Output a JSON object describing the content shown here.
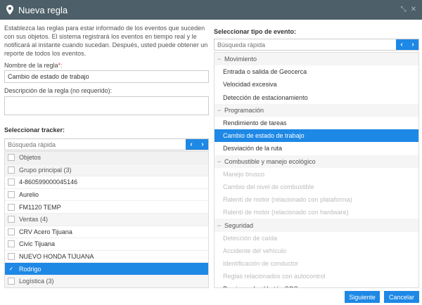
{
  "window": {
    "title": "Nueva regla"
  },
  "intro": "Establezca las reglas para estar informado de los eventos que suceden con sus objetos. El sistema registrará los eventos en tiempo real y le notificará al instante cuando sucedan. Después, usted puede obtener un reporte de todos los eventos.",
  "rule_name": {
    "label": "Nombre de la regla",
    "required_mark": "*:",
    "value": "Cambio de estado de trabajo"
  },
  "description": {
    "label": "Descripción de la regla (no requerido):",
    "value": ""
  },
  "tracker": {
    "title": "Seleccionar tracker:",
    "search_placeholder": "Búsqueda rápida",
    "header": "Objetos",
    "rows": [
      {
        "label": "Grupo principal (3)",
        "type": "group",
        "checked": false
      },
      {
        "label": "4-860599000045146",
        "type": "item",
        "checked": false
      },
      {
        "label": "Aurelio",
        "type": "item",
        "checked": false
      },
      {
        "label": "FM1120 TEMP",
        "type": "item",
        "checked": false
      },
      {
        "label": "Ventas (4)",
        "type": "group",
        "checked": false
      },
      {
        "label": "CRV Acero Tijuana",
        "type": "item",
        "checked": false
      },
      {
        "label": "Civic Tijuana",
        "type": "item",
        "checked": false
      },
      {
        "label": "NUEVO HONDA TIJUANA",
        "type": "item",
        "checked": false
      },
      {
        "label": "Rodrigo",
        "type": "item",
        "checked": true
      },
      {
        "label": "Logística (3)",
        "type": "group",
        "checked": false
      }
    ]
  },
  "events": {
    "title": "Seleccionar tipo de evento:",
    "search_placeholder": "Búsqueda rápida",
    "rows": [
      {
        "label": "Movimiento",
        "type": "group"
      },
      {
        "label": "Entrada o salida de Geocerca",
        "type": "item"
      },
      {
        "label": "Velocidad excesiva",
        "type": "item"
      },
      {
        "label": "Detección de estacionamiento",
        "type": "item"
      },
      {
        "label": "Programación",
        "type": "group"
      },
      {
        "label": "Rendimiento de tareas",
        "type": "item"
      },
      {
        "label": "Cambio de estado de trabajo",
        "type": "item",
        "selected": true
      },
      {
        "label": "Desviación de la ruta",
        "type": "item"
      },
      {
        "label": "Combustible y manejo ecológico",
        "type": "group"
      },
      {
        "label": "Manejo brusco",
        "type": "item",
        "disabled": true
      },
      {
        "label": "Cambio del nivel de combustible",
        "type": "item",
        "disabled": true
      },
      {
        "label": "Ralentí de motor (relacionado con plataforma)",
        "type": "item",
        "disabled": true
      },
      {
        "label": "Ralentí de motor (relacionado con hardware)",
        "type": "item",
        "disabled": true
      },
      {
        "label": "Seguridad",
        "type": "group"
      },
      {
        "label": "Detección de caída",
        "type": "item",
        "disabled": true
      },
      {
        "label": "Accidente del vehículo",
        "type": "item",
        "disabled": true
      },
      {
        "label": "Identificación de conductor",
        "type": "item",
        "disabled": true
      },
      {
        "label": "Reglas relacionados con autocontrol",
        "type": "item",
        "disabled": true
      },
      {
        "label": "Presionando el botón SOS",
        "type": "item"
      }
    ]
  },
  "buttons": {
    "next": "Siguiente",
    "cancel": "Cancelar"
  },
  "colors": {
    "titlebar": "#4d6069",
    "accent": "#1e88e5"
  }
}
